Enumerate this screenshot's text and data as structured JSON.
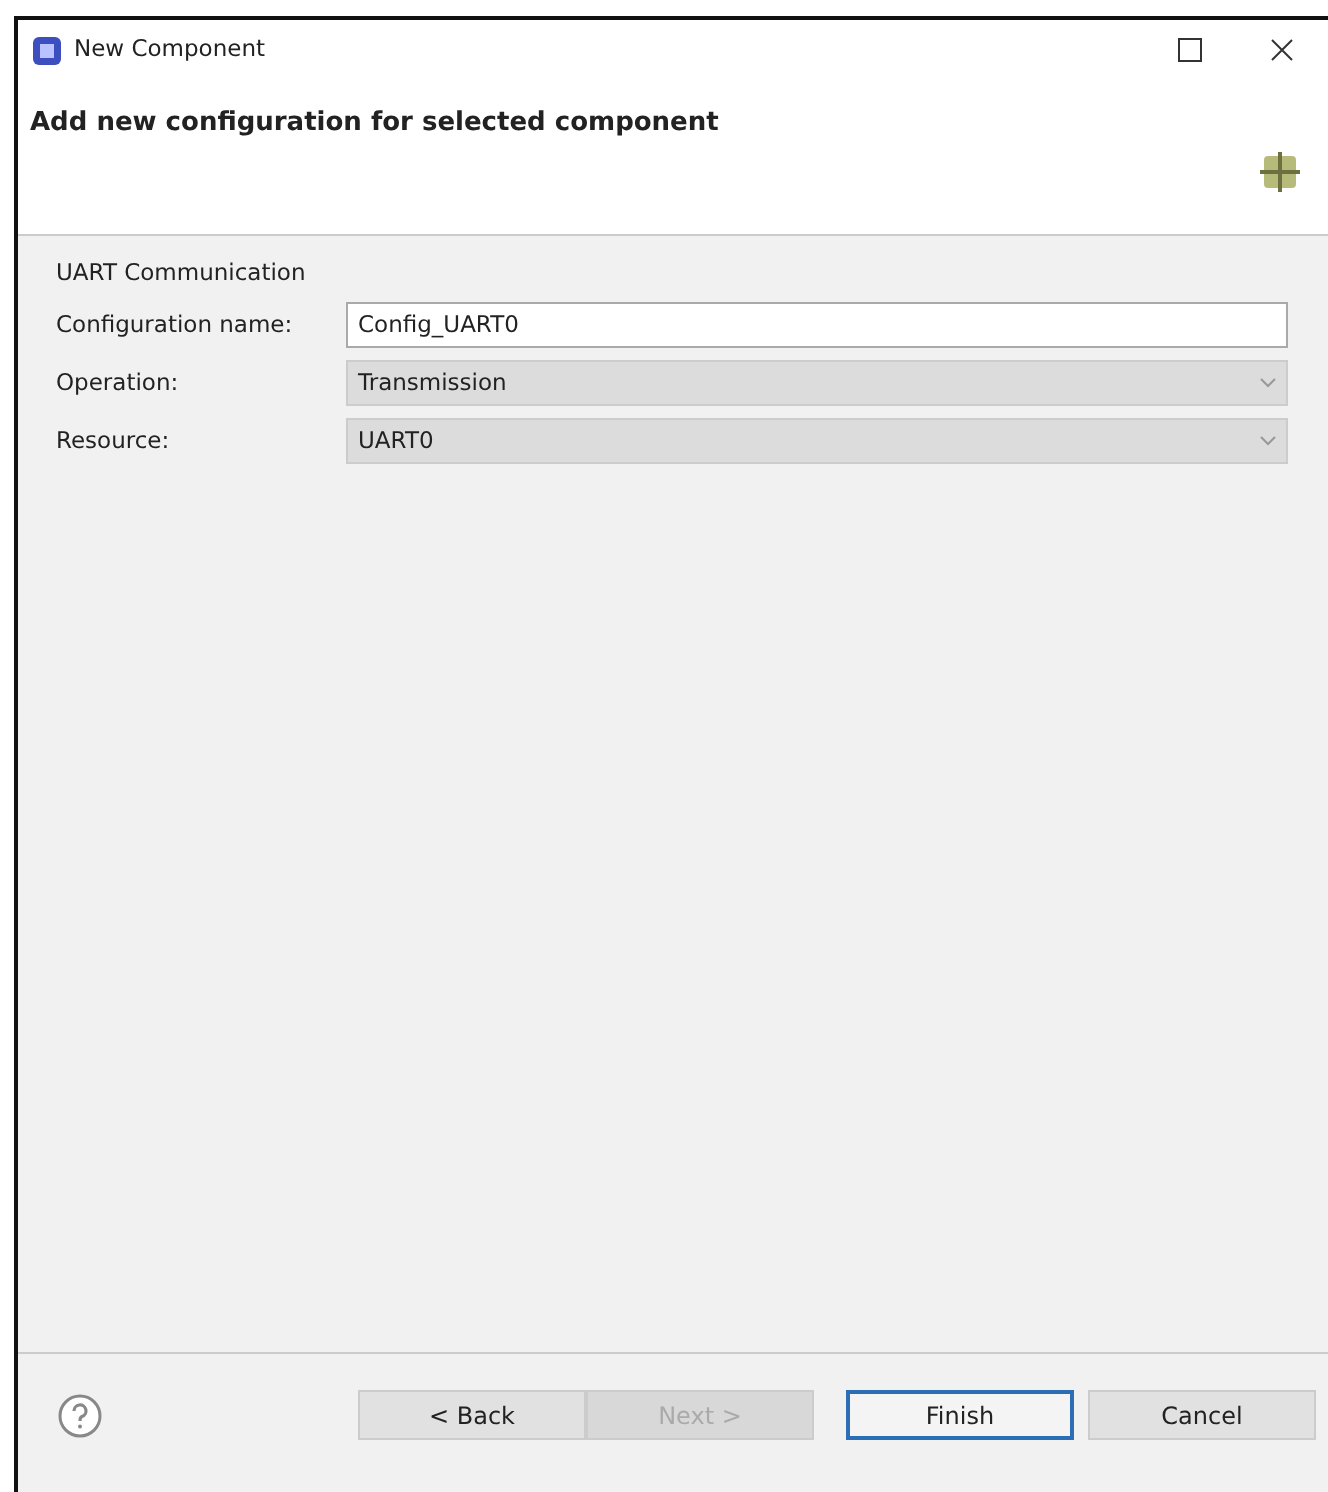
{
  "window": {
    "title": "New Component"
  },
  "header": {
    "title": "Add new configuration for selected component"
  },
  "group": {
    "title": "UART Communication"
  },
  "fields": [
    {
      "kind": "text",
      "label": "Configuration name:",
      "value": "Config_UART0",
      "disabled": false
    },
    {
      "kind": "combo",
      "label": "Operation:",
      "value": "Transmission",
      "disabled": true
    },
    {
      "kind": "combo",
      "label": "Resource:",
      "value": "UART0",
      "disabled": true
    }
  ],
  "buttons": [
    {
      "label": "< Back",
      "disabled": false,
      "default": false
    },
    {
      "label": "Next >",
      "disabled": true,
      "default": false
    },
    {
      "label": "Finish",
      "disabled": false,
      "default": true
    },
    {
      "label": "Cancel",
      "disabled": false,
      "default": false
    }
  ]
}
